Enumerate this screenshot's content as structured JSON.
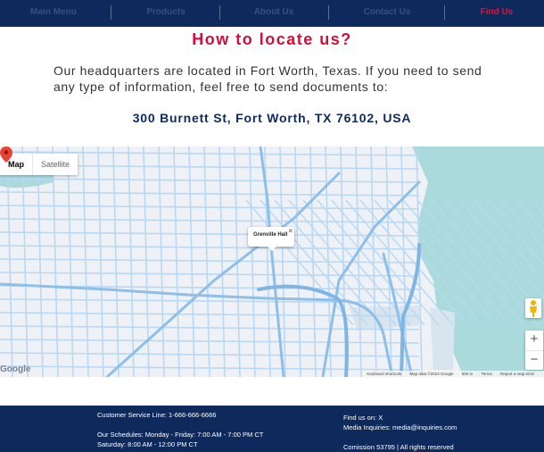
{
  "nav": {
    "items": [
      {
        "label": "Main Menu",
        "active": false
      },
      {
        "label": "Products",
        "active": false
      },
      {
        "label": "About Us",
        "active": false
      },
      {
        "label": "Contact Us",
        "active": false
      },
      {
        "label": "Find Us",
        "active": true
      }
    ]
  },
  "main": {
    "title": "How to locate us?",
    "intro": "Our headquarters are located in Fort Worth, Texas. If you need to send any type of information, feel free to send documents to:",
    "address": "300 Burnett St, Fort Worth, TX 76102, USA"
  },
  "map": {
    "type_buttons": [
      "Map",
      "Satellite"
    ],
    "selected_type": "Map",
    "marker_label": "Grenville Hall",
    "close_glyph": "×",
    "zoom_in": "+",
    "zoom_out": "−",
    "logo": "Google",
    "attribution": [
      "Keyboard shortcuts",
      "Map data ©2024 Google",
      "500 m",
      "Terms",
      "Report a map error"
    ],
    "colors": {
      "water": "#aadadb",
      "roads": "#9cc8f0",
      "marker": "#ea4335",
      "land": "#eef1f5"
    }
  },
  "footer": {
    "customer_service": "Customer Service Line: 1-666-666-6666",
    "schedule_weekdays": "Our Schedules: Monday - Friday: 7:00 AM - 7:00 PM CT",
    "schedule_saturday": "Saturday: 8:00 AM - 12:00 PM CT",
    "social": "Find us on: X",
    "media": "Media Inquiries: media@inquiries.com",
    "commission": "Comission 53795 | All rights reserved"
  },
  "colors": {
    "navy": "#0e2a5c",
    "accent": "#d0103a",
    "active_nav": "#e0103a"
  }
}
